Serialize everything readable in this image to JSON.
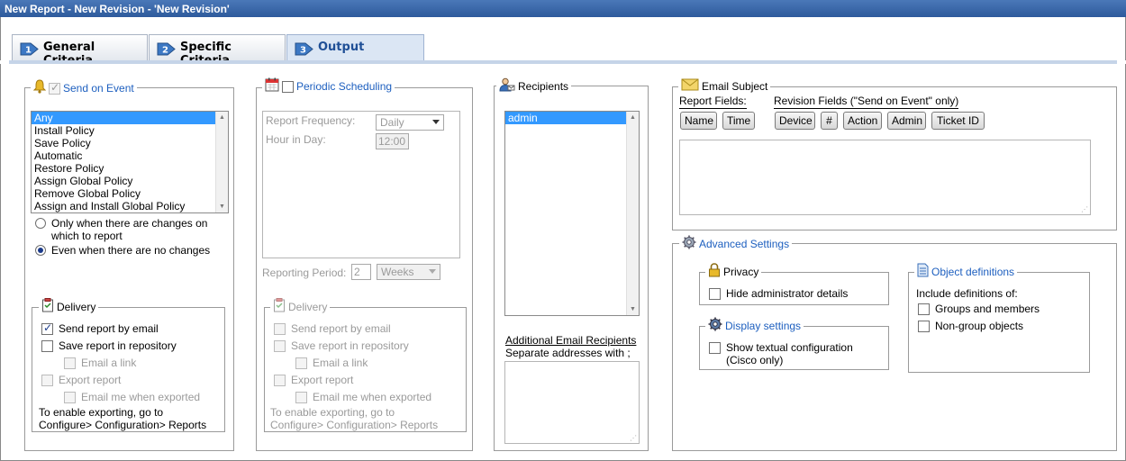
{
  "window": {
    "title": "New Report - New Revision - 'New Revision'"
  },
  "tabs": [
    {
      "num": "1",
      "label": "General Criteria"
    },
    {
      "num": "2",
      "label": "Specific Criteria"
    },
    {
      "num": "3",
      "label": "Output"
    }
  ],
  "send_on_event": {
    "label": "Send on Event",
    "events": [
      "Any",
      "Install Policy",
      "Save Policy",
      "Automatic",
      "Restore Policy",
      "Assign Global Policy",
      "Remove Global Policy",
      "Assign and Install Global Policy"
    ],
    "selected": "Any",
    "radio_changes": "Only when there are changes on",
    "radio_changes_2": "which to report",
    "radio_nochanges": "Even when there are no changes"
  },
  "delivery_left": {
    "label": "Delivery",
    "send_email": "Send report by email",
    "save_repo": "Save report in repository",
    "email_link": "Email a link",
    "export": "Export report",
    "email_exported": "Email me when exported",
    "note_1": "To enable exporting, go to",
    "note_2": "Configure> Configuration> Reports"
  },
  "periodic": {
    "label": "Periodic Scheduling",
    "freq_label": "Report Frequency:",
    "freq_value": "Daily",
    "hour_label": "Hour in Day:",
    "hour_value": "12:00",
    "period_label": "Reporting Period:",
    "period_value": "2",
    "period_unit": "Weeks"
  },
  "delivery_mid": {
    "label": "Delivery",
    "send_email": "Send report by email",
    "save_repo": "Save report in repository",
    "email_link": "Email a link",
    "export": "Export report",
    "email_exported": "Email me when exported",
    "note_1": "To enable exporting, go to",
    "note_2": "Configure> Configuration> Reports"
  },
  "recipients": {
    "label": "Recipients",
    "items": [
      "admin"
    ],
    "additional_label": "Additional Email Recipients",
    "separate_label": "Separate addresses with ;"
  },
  "email_subject": {
    "label": "Email Subject",
    "report_fields_label": "Report Fields:",
    "revision_fields_label": "Revision Fields (\"Send on Event\" only)",
    "report_buttons": [
      "Name",
      "Time"
    ],
    "revision_buttons": [
      "Device",
      "#",
      "Action",
      "Admin",
      "Ticket ID"
    ]
  },
  "advanced": {
    "label": "Advanced Settings",
    "privacy_label": "Privacy",
    "hide_admin": "Hide administrator details",
    "display_label": "Display settings",
    "show_textual": "Show textual configuration",
    "cisco_only": "(Cisco only)",
    "objdef_label": "Object definitions",
    "include_label": "Include definitions of:",
    "groups": "Groups and members",
    "nongroup": "Non-group objects"
  },
  "colors": {
    "accent": "#1d5fbf",
    "selection": "#3399ff",
    "titlebar": "#3a68ac"
  }
}
